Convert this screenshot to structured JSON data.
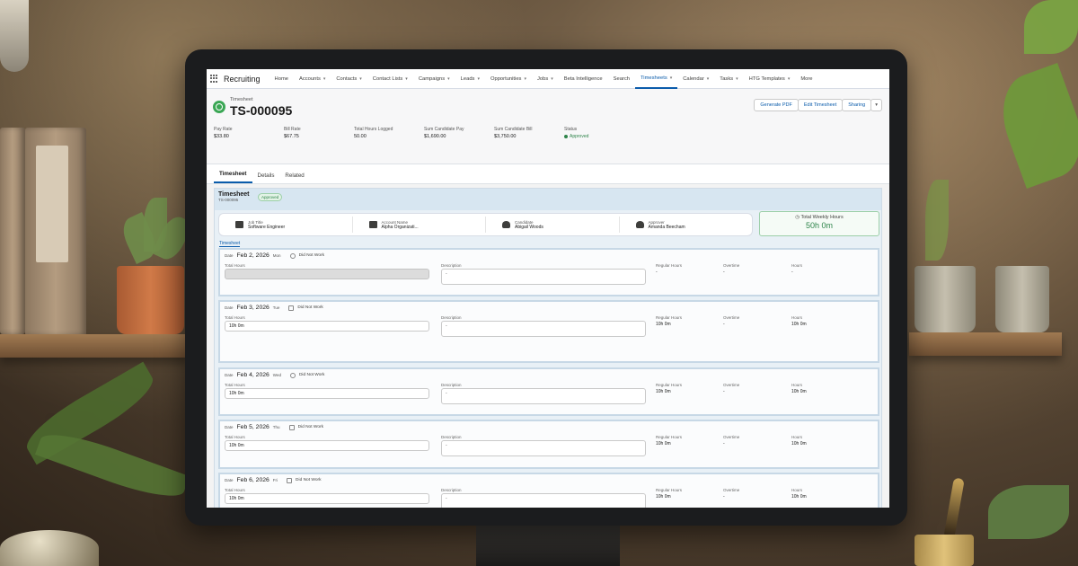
{
  "nav": {
    "app_name": "Recruiting",
    "items": [
      {
        "label": "Home",
        "chev": false,
        "active": false
      },
      {
        "label": "Accounts",
        "chev": true,
        "active": false
      },
      {
        "label": "Contacts",
        "chev": true,
        "active": false
      },
      {
        "label": "Contact Lists",
        "chev": true,
        "active": false
      },
      {
        "label": "Campaigns",
        "chev": true,
        "active": false
      },
      {
        "label": "Leads",
        "chev": true,
        "active": false
      },
      {
        "label": "Opportunities",
        "chev": true,
        "active": false
      },
      {
        "label": "Jobs",
        "chev": true,
        "active": false
      },
      {
        "label": "Beta Intelligence",
        "chev": false,
        "active": false
      },
      {
        "label": "Search",
        "chev": false,
        "active": false
      },
      {
        "label": "Timesheets",
        "chev": true,
        "active": true
      },
      {
        "label": "Calendar",
        "chev": true,
        "active": false
      },
      {
        "label": "Tasks",
        "chev": true,
        "active": false
      },
      {
        "label": "HTG Templates",
        "chev": true,
        "active": false
      },
      {
        "label": "More",
        "chev": false,
        "active": false
      }
    ]
  },
  "record": {
    "type_label": "Timesheet",
    "name": "TS-000095",
    "actions": [
      "Generate PDF",
      "Edit Timesheet",
      "Sharing"
    ],
    "fields": [
      {
        "label": "Pay Rate",
        "value": "$33.80"
      },
      {
        "label": "Bill Rate",
        "value": "$67.75"
      },
      {
        "label": "Total Hours Logged",
        "value": "50.00"
      },
      {
        "label": "Sum Candidate Pay",
        "value": "$1,690.00"
      },
      {
        "label": "Sum Candidate Bill",
        "value": "$3,750.00"
      }
    ],
    "status_label": "Status",
    "status_value": "Approved"
  },
  "tabs": [
    {
      "label": "Timesheet",
      "active": true
    },
    {
      "label": "Details",
      "active": false
    },
    {
      "label": "Related",
      "active": false
    }
  ],
  "panel": {
    "title": "Timesheet",
    "subtitle": "TS-000095",
    "badge": "Approved",
    "summary": [
      {
        "icon": "briefcase-icon",
        "label": "Job Title",
        "value": "Software Engineer"
      },
      {
        "icon": "building-icon",
        "label": "Account Name",
        "value": "Alpha Organizati..."
      },
      {
        "icon": "person-icon",
        "label": "Candidate",
        "value": "Abigail Woods"
      },
      {
        "icon": "person-icon",
        "label": "Approver",
        "value": "Amanda Beecham"
      }
    ],
    "total_label": "Total Weekly Hours",
    "total_value": "50h 0m",
    "sub_tab": "Timesheet",
    "labels": {
      "date": "Date",
      "total_hours": "Total Hours",
      "description": "Description",
      "regular_hours": "Regular Hours",
      "overtime": "Overtime",
      "hours": "Hours",
      "did_not_work": "Did Not Work"
    },
    "days": [
      {
        "date": "Feb 2, 2026",
        "dow": "Mon",
        "total": "",
        "desc": "-",
        "regular": "-",
        "overtime": "-",
        "hours": "-",
        "disabled": true
      },
      {
        "date": "Feb 3, 2026",
        "dow": "Tue",
        "total": "10h 0m",
        "desc": "-",
        "regular": "10h 0m",
        "overtime": "-",
        "hours": "10h 0m",
        "disabled": false
      },
      {
        "date": "Feb 4, 2026",
        "dow": "Wed",
        "total": "10h 0m",
        "desc": "-",
        "regular": "10h 0m",
        "overtime": "-",
        "hours": "10h 0m",
        "disabled": false
      },
      {
        "date": "Feb 5, 2026",
        "dow": "Thu",
        "total": "10h 0m",
        "desc": "-",
        "regular": "10h 0m",
        "overtime": "-",
        "hours": "10h 0m",
        "disabled": false
      },
      {
        "date": "Feb 6, 2026",
        "dow": "Fri",
        "total": "10h 0m",
        "desc": "-",
        "regular": "10h 0m",
        "overtime": "-",
        "hours": "10h 0m",
        "disabled": false
      }
    ]
  }
}
